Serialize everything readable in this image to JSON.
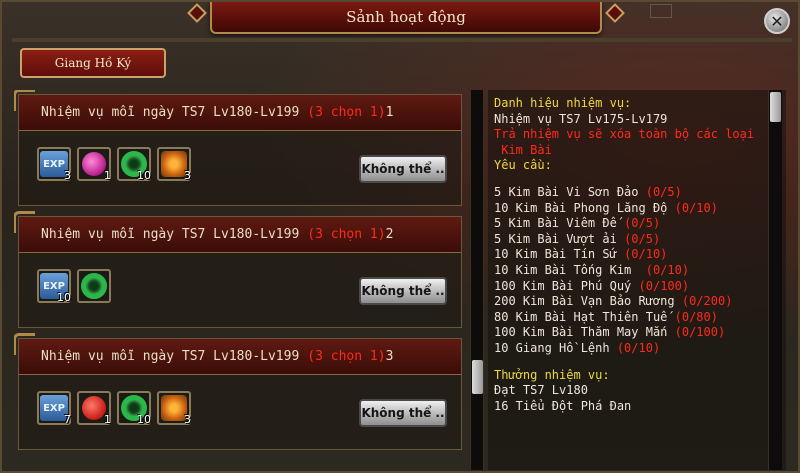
{
  "window": {
    "title": "Sảnh hoạt động",
    "close_label": "✕",
    "tab_label": "Giang Hồ Ký"
  },
  "quests": [
    {
      "title": "Nhiệm vụ mỗi ngày TS7 Lv180-Lv199",
      "choose": "(3 chọn 1)",
      "index": "1",
      "button": "Không thể ..",
      "items": [
        {
          "icon": "exp-icon",
          "label": "EXP",
          "count": "3"
        },
        {
          "icon": "pink-bag-icon",
          "label": "",
          "count": "1"
        },
        {
          "icon": "jade-ring-icon",
          "label": "",
          "count": "10"
        },
        {
          "icon": "gift-box-icon",
          "label": "",
          "count": "3"
        }
      ]
    },
    {
      "title": "Nhiệm vụ mỗi ngày TS7 Lv180-Lv199",
      "choose": "(3 chọn 1)",
      "index": "2",
      "button": "Không thể ..",
      "items": [
        {
          "icon": "exp-icon",
          "label": "EXP",
          "count": "10"
        },
        {
          "icon": "jade-ring-icon",
          "label": "",
          "count": ""
        }
      ]
    },
    {
      "title": "Nhiệm vụ mỗi ngày TS7 Lv180-Lv199",
      "choose": "(3 chọn 1)",
      "index": "3",
      "button": "Không thể ..",
      "items": [
        {
          "icon": "exp-icon",
          "label": "EXP",
          "count": "7"
        },
        {
          "icon": "red-bag-icon",
          "label": "",
          "count": "1"
        },
        {
          "icon": "jade-ring-icon",
          "label": "",
          "count": "10"
        },
        {
          "icon": "gift-box-icon",
          "label": "",
          "count": "3"
        }
      ]
    }
  ],
  "detail": {
    "heading": "Danh hiệu nhiệm vụ:",
    "quest_name": "Nhiệm vụ TS7 Lv175-Lv179",
    "warning_1": "Trả nhiệm vụ sẽ xóa toàn bộ các loại",
    "warning_2": " Kim Bài",
    "requirements_label": "Yêu cầu:",
    "requirements": [
      {
        "text": "5 Kim Bài Vi Sơn Đảo",
        "progress": "(0/5)"
      },
      {
        "text": "10 Kim Bài Phong Lăng Độ",
        "progress": "(0/10)"
      },
      {
        "text": "5 Kim Bài Viêm Đế",
        "progress": "(0/5)"
      },
      {
        "text": "5 Kim Bài Vượt ải",
        "progress": "(0/5)"
      },
      {
        "text": "10 Kim Bài Tín Sứ",
        "progress": "(0/10)"
      },
      {
        "text": "10 Kim Bài Tống Kim",
        "progress": " (0/10)"
      },
      {
        "text": "100 Kim Bài Phú Quý",
        "progress": "(0/100)"
      },
      {
        "text": "200 Kim Bài Vạn Bảo Rương",
        "progress": "(0/200)"
      },
      {
        "text": "80 Kim Bài Hạt Thiên Tuế",
        "progress": "(0/80)"
      },
      {
        "text": "100 Kim Bài Thăm May Mắn",
        "progress": "(0/100)"
      },
      {
        "text": "10 Giang Hồ Lệnh",
        "progress": "(0/10)"
      }
    ],
    "rewards_label": "Thưởng nhiệm vụ:",
    "rewards": [
      "Đạt TS7 Lv180",
      "16 Tiểu Đột Phá Đan"
    ]
  }
}
